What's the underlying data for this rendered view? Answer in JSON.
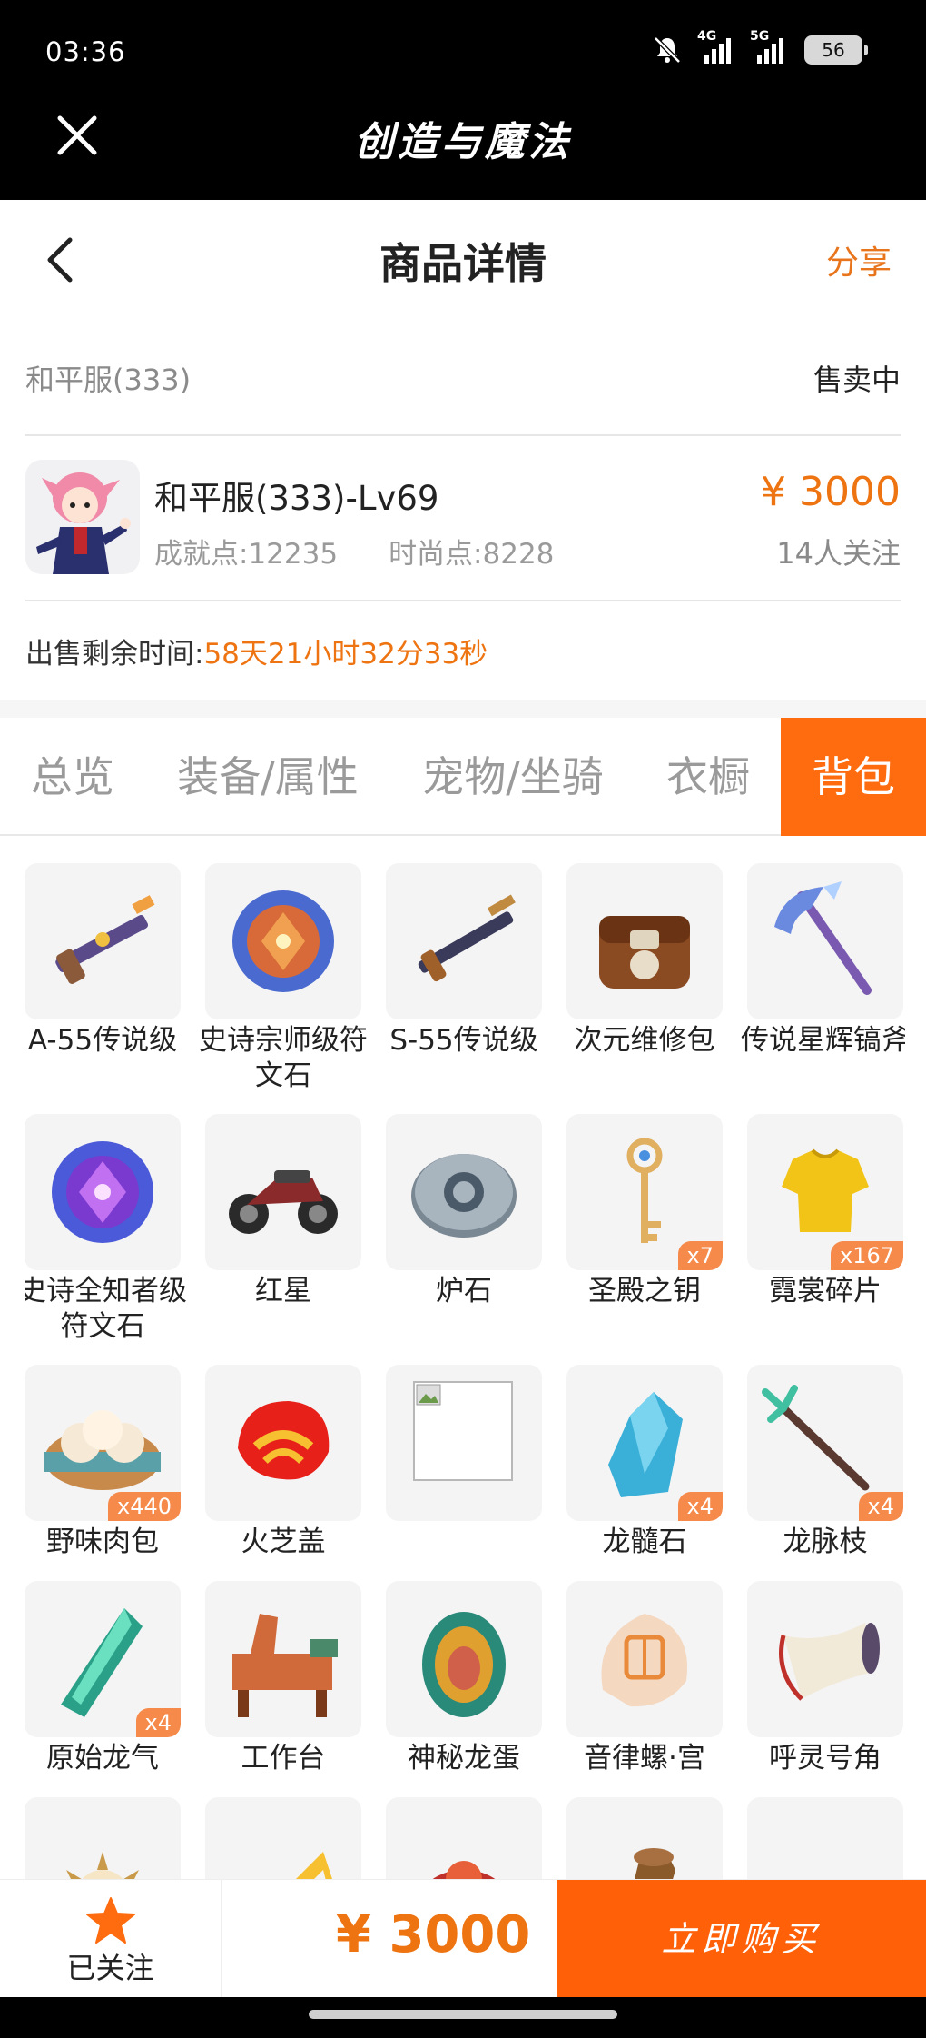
{
  "status_bar": {
    "time": "03:36",
    "signal_1": "4G",
    "signal_2": "5G",
    "battery": "56"
  },
  "app": {
    "title": "创造与魔法"
  },
  "header": {
    "title": "商品详情",
    "share": "分享"
  },
  "product": {
    "server": "和平服(333)",
    "status": "售卖中",
    "name": "和平服(333)-Lv69",
    "achievement": "成就点:12235",
    "fashion": "时尚点:8228",
    "price": "¥ 3000",
    "followers": "14人关注",
    "remaining_label": "出售剩余时间:",
    "remaining_value": "58天21小时32分33秒"
  },
  "tabs": [
    {
      "label": "总览",
      "active": false
    },
    {
      "label": "装备/属性",
      "active": false
    },
    {
      "label": "宠物/坐骑",
      "active": false
    },
    {
      "label": "衣橱",
      "active": false
    },
    {
      "label": "背包",
      "active": true
    }
  ],
  "items": [
    {
      "name": "A-55传说级",
      "icon": "legendary-gun-icon",
      "count": ""
    },
    {
      "name": "史诗宗师级符文石",
      "icon": "rune-stone-icon",
      "count": ""
    },
    {
      "name": "S-55传说级",
      "icon": "legendary-rifle-icon",
      "count": ""
    },
    {
      "name": "次元维修包",
      "icon": "repair-bag-icon",
      "count": ""
    },
    {
      "name": "传说星辉镐斧",
      "icon": "pickaxe-icon",
      "count": ""
    },
    {
      "name": "史诗全知者级符文石",
      "icon": "rune-stone-purple-icon",
      "count": ""
    },
    {
      "name": "红星",
      "icon": "motorcycle-icon",
      "count": ""
    },
    {
      "name": "炉石",
      "icon": "hearthstone-icon",
      "count": ""
    },
    {
      "name": "圣殿之钥",
      "icon": "key-icon",
      "count": "x7"
    },
    {
      "name": "霓裳碎片",
      "icon": "shirt-icon",
      "count": "x167"
    },
    {
      "name": "野味肉包",
      "icon": "bun-basket-icon",
      "count": "x440"
    },
    {
      "name": "火芝盖",
      "icon": "mushroom-icon",
      "count": ""
    },
    {
      "name": "",
      "icon": "broken-image-icon",
      "count": ""
    },
    {
      "name": "龙髓石",
      "icon": "crystal-icon",
      "count": "x4"
    },
    {
      "name": "龙脉枝",
      "icon": "branch-icon",
      "count": "x4"
    },
    {
      "name": "原始龙气",
      "icon": "green-crystal-icon",
      "count": "x4"
    },
    {
      "name": "工作台",
      "icon": "workbench-icon",
      "count": ""
    },
    {
      "name": "神秘龙蛋",
      "icon": "dragon-egg-icon",
      "count": ""
    },
    {
      "name": "音律螺·宫",
      "icon": "conch-icon",
      "count": ""
    },
    {
      "name": "呼灵号角",
      "icon": "horn-icon",
      "count": ""
    },
    {
      "name": "",
      "icon": "sun-eye-icon",
      "count": ""
    },
    {
      "name": "",
      "icon": "megaphone-icon",
      "count": ""
    },
    {
      "name": "",
      "icon": "red-item-icon",
      "count": ""
    },
    {
      "name": "",
      "icon": "wood-item-icon",
      "count": ""
    },
    {
      "name": "",
      "icon": "soup-bowl-icon",
      "count": ""
    }
  ],
  "bottom": {
    "follow_label": "已关注",
    "price": "¥ 3000",
    "buy_label": "立即购买"
  },
  "colors": {
    "accent": "#ff6c10",
    "price": "#ee7412",
    "badge": "#f68a4a"
  }
}
